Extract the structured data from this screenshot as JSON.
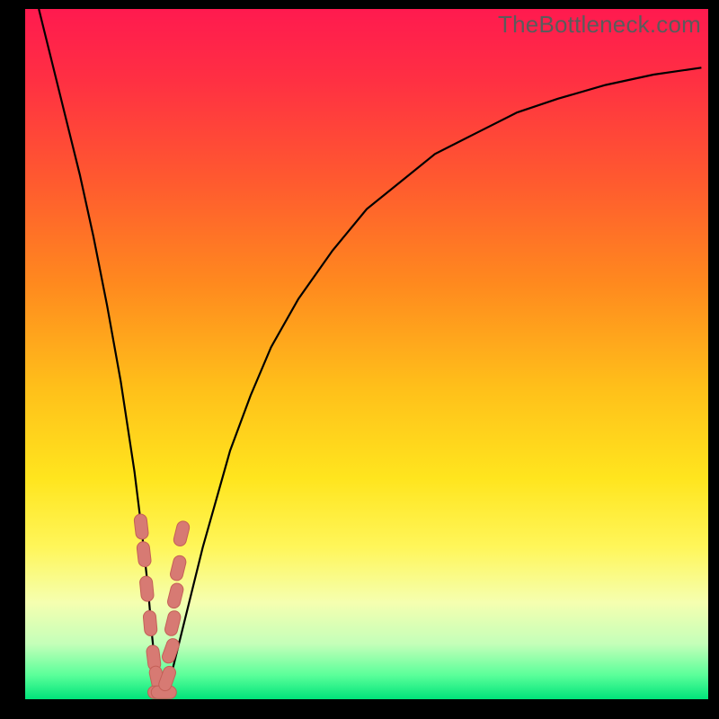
{
  "watermark": "TheBottleneck.com",
  "colors": {
    "frame": "#000000",
    "curve": "#000000",
    "marker_fill": "#d77a73",
    "marker_stroke": "#c45f57",
    "gradient_stops": [
      {
        "offset": 0.0,
        "color": "#ff1a4f"
      },
      {
        "offset": 0.1,
        "color": "#ff2f43"
      },
      {
        "offset": 0.25,
        "color": "#ff5a2f"
      },
      {
        "offset": 0.4,
        "color": "#ff8a1e"
      },
      {
        "offset": 0.55,
        "color": "#ffc01a"
      },
      {
        "offset": 0.68,
        "color": "#ffe51e"
      },
      {
        "offset": 0.78,
        "color": "#fff65a"
      },
      {
        "offset": 0.86,
        "color": "#f5ffb0"
      },
      {
        "offset": 0.92,
        "color": "#c4ffb9"
      },
      {
        "offset": 0.965,
        "color": "#5bff9a"
      },
      {
        "offset": 1.0,
        "color": "#00e47a"
      }
    ]
  },
  "chart_data": {
    "type": "line",
    "title": "",
    "xlabel": "",
    "ylabel": "",
    "xlim": [
      0,
      100
    ],
    "ylim": [
      0,
      100
    ],
    "annotations": [
      "TheBottleneck.com"
    ],
    "series": [
      {
        "name": "bottleneck-curve",
        "x": [
          2,
          4,
          6,
          8,
          10,
          12,
          14,
          16,
          17,
          18,
          18.5,
          19,
          19.5,
          20,
          21,
          22,
          24,
          26,
          28,
          30,
          33,
          36,
          40,
          45,
          50,
          55,
          60,
          66,
          72,
          78,
          85,
          92,
          99
        ],
        "y": [
          100,
          92,
          84,
          76,
          67,
          57,
          46,
          33,
          25,
          16,
          10,
          5,
          2,
          0.5,
          2,
          6,
          14,
          22,
          29,
          36,
          44,
          51,
          58,
          65,
          71,
          75,
          79,
          82,
          85,
          87,
          89,
          90.5,
          91.5
        ]
      }
    ],
    "markers": {
      "name": "highlighted-points",
      "shape": "rounded-capsule",
      "x": [
        17.0,
        17.4,
        17.8,
        18.3,
        18.8,
        19.3,
        19.8,
        20.3,
        20.8,
        21.3,
        21.6,
        22.0,
        22.4,
        22.9
      ],
      "y": [
        25,
        21,
        16,
        11,
        6,
        3,
        1,
        1,
        3,
        7,
        11,
        15,
        19,
        24
      ]
    }
  }
}
